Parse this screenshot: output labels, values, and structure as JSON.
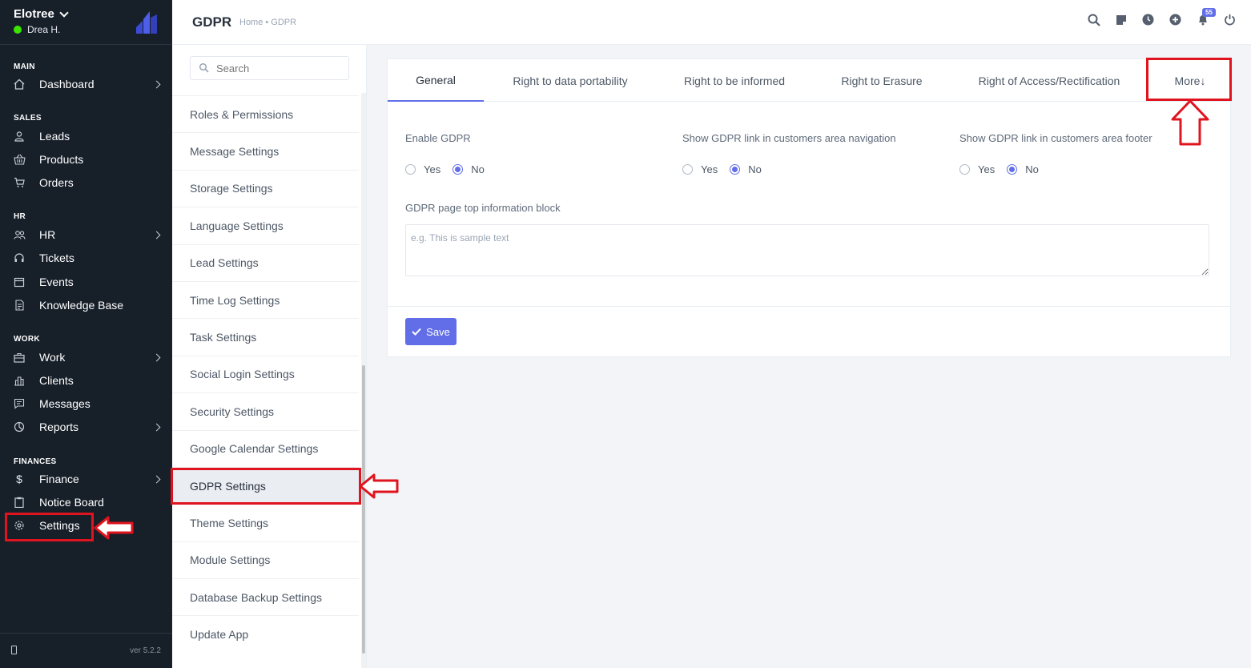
{
  "sidebar": {
    "company": "Elotree",
    "user": "Drea H.",
    "version": "ver 5.2.2",
    "sections": {
      "main": "MAIN",
      "sales": "SALES",
      "hr": "HR",
      "work": "WORK",
      "finances": "FINANCES"
    },
    "items": {
      "dashboard": "Dashboard",
      "leads": "Leads",
      "products": "Products",
      "orders": "Orders",
      "hr": "HR",
      "tickets": "Tickets",
      "events": "Events",
      "knowledge_base": "Knowledge Base",
      "work": "Work",
      "clients": "Clients",
      "messages": "Messages",
      "reports": "Reports",
      "finance": "Finance",
      "notice_board": "Notice Board",
      "settings": "Settings"
    },
    "finance_icon": "$"
  },
  "header": {
    "title": "GDPR",
    "breadcrumb": "Home • GDPR",
    "notification_count": "55"
  },
  "settings_menu": {
    "search_placeholder": "Search",
    "items": [
      "Roles & Permissions",
      "Message Settings",
      "Storage Settings",
      "Language Settings",
      "Lead Settings",
      "Time Log Settings",
      "Task Settings",
      "Social Login Settings",
      "Security Settings",
      "Google Calendar Settings",
      "GDPR Settings",
      "Theme Settings",
      "Module Settings",
      "Database Backup Settings",
      "Update App"
    ]
  },
  "tabs": {
    "general": "General",
    "portability": "Right to data portability",
    "informed": "Right to be informed",
    "erasure": "Right to Erasure",
    "access": "Right of Access/Rectification",
    "more": "More↓"
  },
  "form": {
    "enable_gdpr": "Enable GDPR",
    "show_nav": "Show GDPR link in customers area navigation",
    "show_footer": "Show GDPR link in customers area footer",
    "yes": "Yes",
    "no": "No",
    "info_block_label": "GDPR page top information block",
    "info_block_placeholder": "e.g. This is sample text",
    "save": "Save"
  },
  "colors": {
    "accent": "#616ee8",
    "sidebar_bg": "#171f29",
    "highlight": "#e0141e"
  }
}
